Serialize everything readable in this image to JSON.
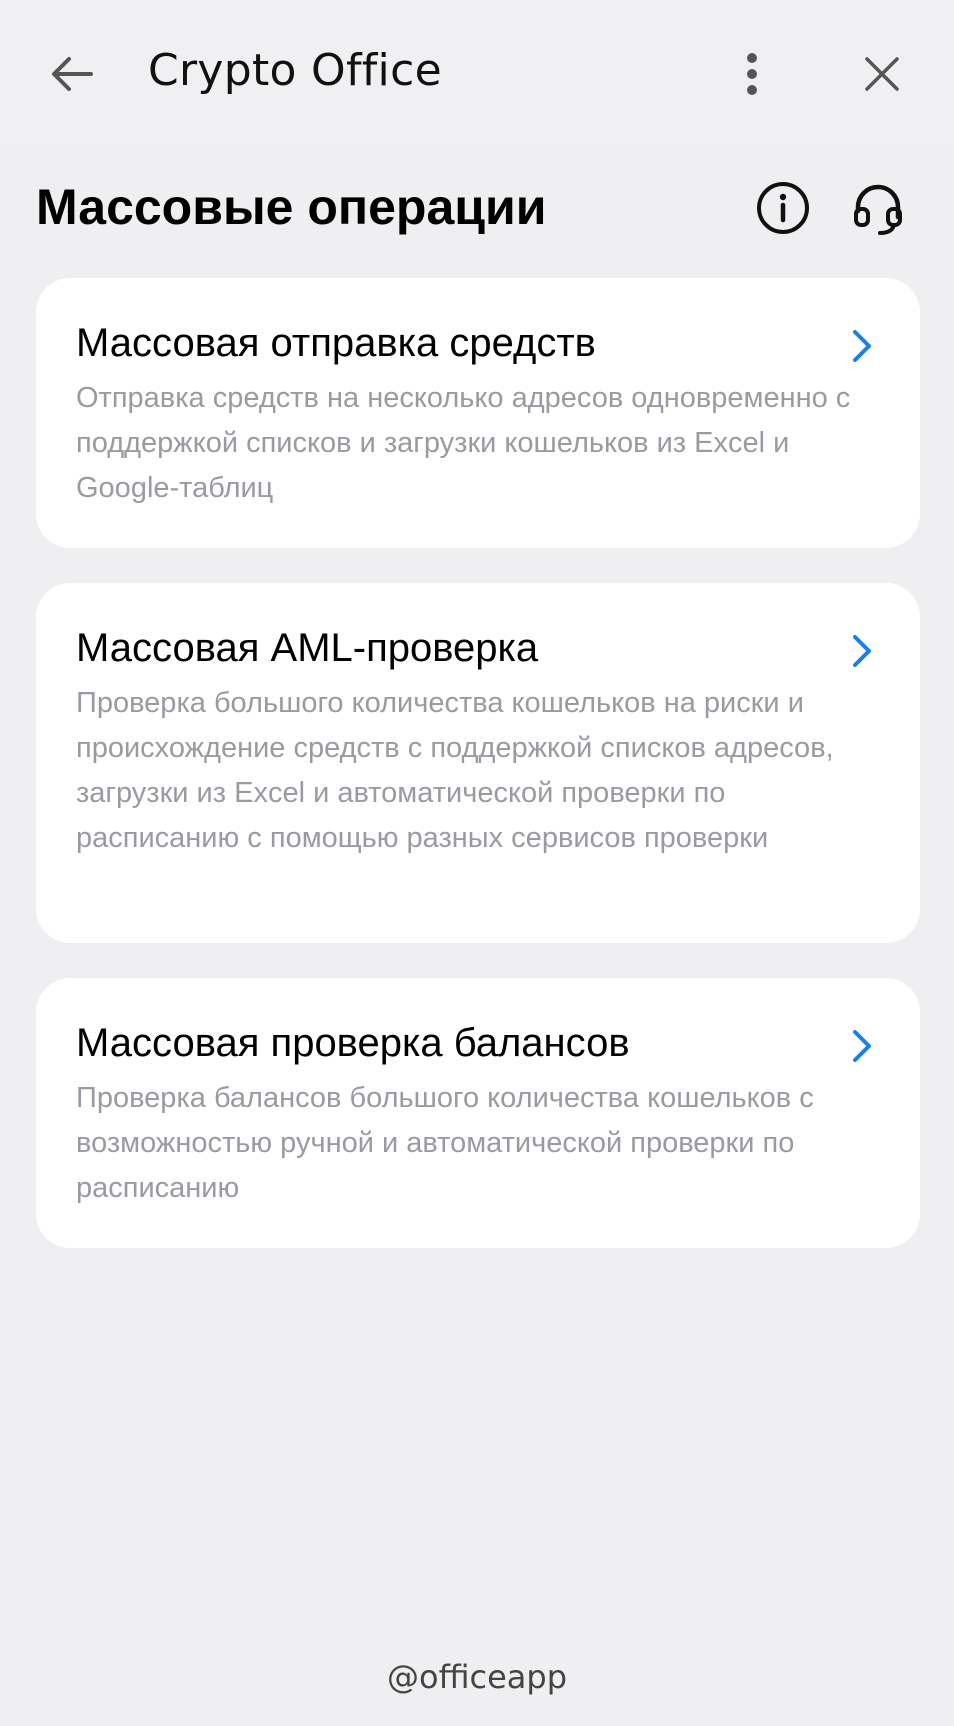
{
  "header": {
    "title": "Crypto Office",
    "back_icon": "arrow-left-icon",
    "more_icon": "more-vertical-icon",
    "close_icon": "close-icon"
  },
  "page": {
    "title": "Массовые операции",
    "info_icon": "info-icon",
    "support_icon": "headset-icon"
  },
  "cards": [
    {
      "title": "Массовая отправка средств",
      "description": "Отправка средств на несколько адресов одновременно с поддержкой списков и загрузки кошельков из Excel и Google-таблиц"
    },
    {
      "title": "Массовая AML-проверка",
      "description": "Проверка большого количества кошельков на риски и происхождение средств с поддержкой списков адресов, загрузки из Excel и автоматической проверки по расписанию с помощью разных сервисов проверки"
    },
    {
      "title": "Массовая проверка балансов",
      "description": "Проверка балансов большого количества кошельков с возможностью ручной и автоматической проверки по расписанию"
    }
  ],
  "footer": {
    "handle": "@officeapp"
  },
  "colors": {
    "background": "#efeff1",
    "card": "#ffffff",
    "accent": "#1a7fe6",
    "secondary_text": "#9a9aa0"
  }
}
